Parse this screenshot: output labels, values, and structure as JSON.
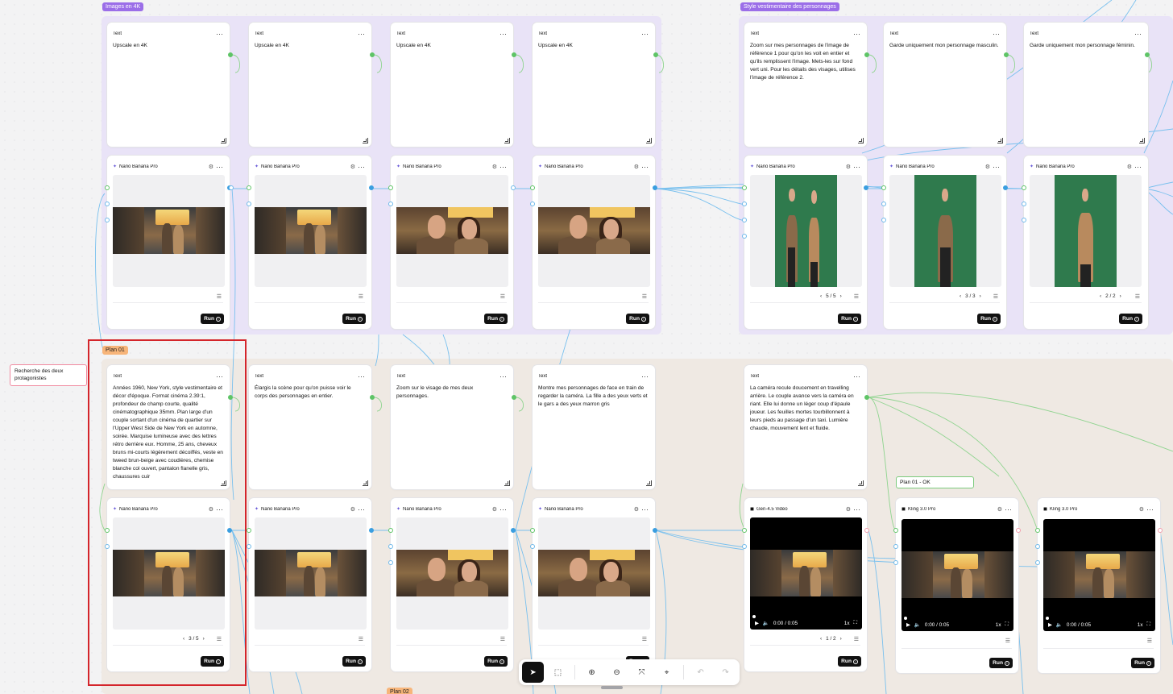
{
  "groups": [
    {
      "label": "Images en 4K",
      "color": "purple"
    },
    {
      "label": "Style vestimentaire des personnages",
      "color": "purple"
    },
    {
      "label": "Plan 01",
      "color": "orange"
    },
    {
      "label": "Plan 02",
      "color": "orange"
    }
  ],
  "side_label": "Recherche des deux protagonistes",
  "ok_label": "Plan 01 - OK",
  "common": {
    "text_title": "Text",
    "run": "Run",
    "nano_model": "Nano Banana Pro",
    "info_glyph": "i"
  },
  "row1_text": [
    {
      "content": "Upscale en 4K"
    },
    {
      "content": "Upscale en 4K"
    },
    {
      "content": "Upscale en 4K"
    },
    {
      "content": "Upscale en 4K"
    },
    {
      "content": "Zoom sur mes personnages de l'image de référence 1 pour qu'on les voit en entier et qu'ils remplissent l'image. Mets-les sur fond vert uni. Pour les détails des visages, utilises l'image de référence 2."
    },
    {
      "content": "Garde uniquement mon personnage masculin."
    },
    {
      "content": "Garde uniquement mon personnage féminin."
    }
  ],
  "row1_gen_pagers": [
    "5 / 5",
    "3 / 3",
    "2 / 2"
  ],
  "row2_text": [
    {
      "content": "Années 1960, New York, style vestimentaire et décor d'époque. Format cinéma 2.39:1, profondeur de champ courte, qualité cinématographique 35mm. Plan large d'un couple sortant d'un cinéma de quartier sur l'Upper West Side de New York en automne, soirée. Marquise lumineuse avec des lettres rétro derrière eux. Homme, 25 ans, cheveux bruns mi-courts légèrement décoiffés, veste en tweed brun-beige avec coudières, chemise blanche col ouvert, pantalon flanelle gris, chaussures cuir"
    },
    {
      "content": "Élargis la scène pour qu'on puisse voir le corps des personnages en entier."
    },
    {
      "content": "Zoom sur le visage de mes deux personnages."
    },
    {
      "content": "Montre mes personnages de face en train de regarder la caméra. La fille a des yeux verts et le gars a des yeux marron gris"
    },
    {
      "content": "La caméra recule doucement en travelling arrière. Le couple avance vers la caméra en riant. Elle lui donne un léger coup d'épaule joueur. Les feuilles mortes tourbillonnent à leurs pieds au passage d'un taxi. Lumière chaude, mouvement lent et fluide."
    }
  ],
  "row2_gen_pager": "3 / 5",
  "videos": [
    {
      "model": "Gen-4.5 Video",
      "time": "0:00 / 0:05",
      "speed": "1x",
      "pager": "1 / 2"
    },
    {
      "model": "Kling 3.0 Pro",
      "time": "0:00 / 0:05",
      "speed": "1x"
    },
    {
      "model": "Kling 3.0 Pro",
      "time": "0:00 / 0:05",
      "speed": "1x"
    }
  ],
  "icons": {
    "more": "more-icon",
    "settings": "sliders-icon",
    "list": "list-icon",
    "pointer": "pointer-icon",
    "select": "select-icon",
    "zoom_in": "zoom-in-icon",
    "zoom_out": "zoom-out-icon",
    "fit": "fit-icon",
    "focus": "focus-icon",
    "undo": "undo-icon",
    "redo": "redo-icon"
  },
  "colors": {
    "purple_group": "#e9e3f7",
    "beige_group": "#efe9e3",
    "selection": "#d4252b",
    "run": "#111111"
  }
}
